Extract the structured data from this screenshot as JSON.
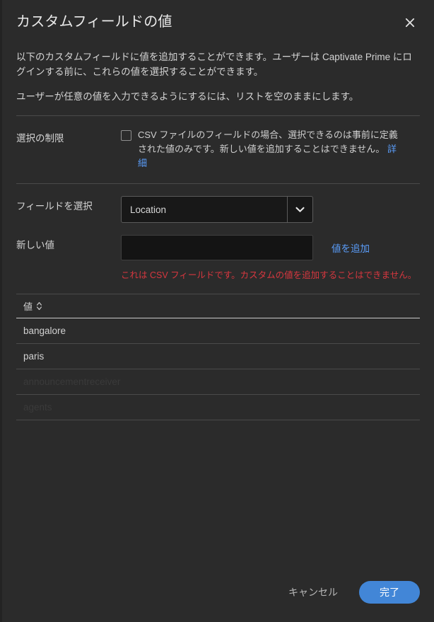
{
  "dialog": {
    "title": "カスタムフィールドの値",
    "close_icon": "close-icon",
    "intro": {
      "paragraph1": "以下のカスタムフィールドに値を追加することができます。ユーザーは Captivate Prime にログインする前に、これらの値を選択することができます。",
      "paragraph2": "ユーザーが任意の値を入力できるようにするには、リストを空のままにします。"
    },
    "restriction": {
      "label": "選択の制限",
      "checkbox_checked": false,
      "description": "CSV ファイルのフィールドの場合、選択できるのは事前に定義された値のみです。新しい値を追加することはできません。",
      "link_label": "詳細"
    },
    "field_select": {
      "label": "フィールドを選択",
      "value": "Location",
      "chevron_icon": "chevron-down-icon",
      "options": [
        "Location"
      ]
    },
    "new_value": {
      "label": "新しい値",
      "input_value": "",
      "input_placeholder": "",
      "add_link_label": "値を追加",
      "error_message": "これは CSV フィールドです。カスタムの値を追加することはできません。"
    },
    "table": {
      "column_header": "値",
      "sort_icon": "sort-updown-icon",
      "rows": [
        {
          "value": "bangalore",
          "dimmed": false
        },
        {
          "value": "paris",
          "dimmed": false
        },
        {
          "value": "announcementreceiver",
          "dimmed": true
        },
        {
          "value": "agents",
          "dimmed": true
        }
      ]
    },
    "footer": {
      "cancel_label": "キャンセル",
      "done_label": "完了"
    },
    "colors": {
      "background": "#2b2b2b",
      "accent_blue": "#4286d7",
      "link_blue": "#5a9cf8",
      "error_red": "#d7373f",
      "input_background": "#141414"
    }
  }
}
